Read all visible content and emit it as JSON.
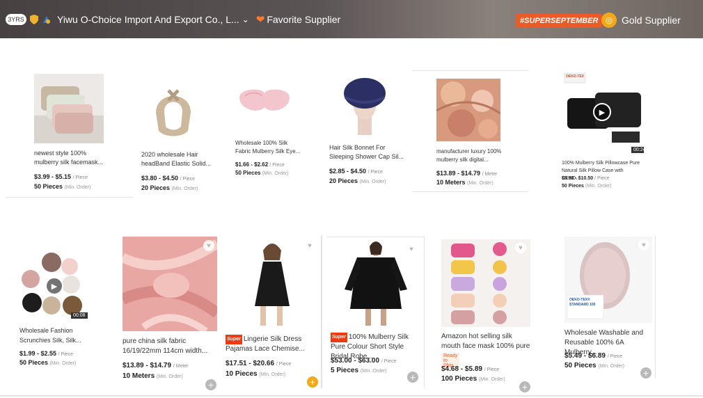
{
  "header": {
    "years": "3YRS",
    "company": "Yiwu O-Choice Import And Export Co., L...",
    "favorite": "Favorite Supplier",
    "promo": "#SUPERSEPTEMBER",
    "gold": "Gold Supplier"
  },
  "row1": [
    {
      "title": "newest style 100% mulberry silk facemask...",
      "price": "$3.99 - $5.15",
      "unit": "/ Piece",
      "moq": "50 Pieces",
      "moq_label": "(Min. Order)"
    },
    {
      "title": "2020 wholesale Hair headBand Elastic Solid...",
      "price": "$3.80 - $4.50",
      "unit": "/ Piece",
      "moq": "20 Pieces",
      "moq_label": "(Min. Order)"
    },
    {
      "title": "Wholesale 100% Silk Fabric Mulberry Silk Eye...",
      "price": "$1.66 - $2.62",
      "unit": "/ Piece",
      "moq": "50 Pieces",
      "moq_label": "(Min. Order)"
    },
    {
      "title": "Hair Silk Bonnet For Sleeping Shower Cap Sil...",
      "price": "$2.85 - $4.50",
      "unit": "/ Piece",
      "moq": "20 Pieces",
      "moq_label": "(Min. Order)"
    },
    {
      "title": "manufacturer luxury 100% mulberry silk digital...",
      "price": "$13.89 - $14.79",
      "unit": "/ Meter",
      "moq": "10 Meters",
      "moq_label": "(Min. Order)"
    },
    {
      "title": "100% Mulberry Silk Pillowcase Pure Natural Silk Pillow Case with OEKO...",
      "price": "$8.90 - $10.50",
      "unit": "/ Piece",
      "moq": "50 Pieces",
      "moq_label": "(Min. Order)",
      "duration": "00:24",
      "badge": "OEKO-TEX"
    }
  ],
  "row2": [
    {
      "title": "Wholesale Fashion Scrunchies Silk, Silk...",
      "price": "$1.99 - $2.55",
      "unit": "/ Piece",
      "moq": "50 Pieces",
      "moq_label": "(Min. Order)",
      "duration": "00:08"
    },
    {
      "title": "pure china silk fabric 16/19/22mm 114cm width...",
      "price": "$13.89 - $14.79",
      "unit": "/ Meter",
      "moq": "10 Meters",
      "moq_label": "(Min. Order)"
    },
    {
      "title": "Lingerie Silk Dress Pajamas Lace Chemise...",
      "price": "$17.51 - $20.66",
      "unit": "/ Piece",
      "moq": "10 Pieces",
      "moq_label": "(Min. Order)",
      "super": "Super"
    },
    {
      "title": "100% Mulberry Silk Pure Colour Short Style Bridal Robe...",
      "price": "$53.00 - $63.00",
      "unit": "/ Piece",
      "moq": "5 Pieces",
      "moq_label": "(Min. Order)",
      "super": "Super"
    },
    {
      "title": "Amazon hot selling silk mouth face mask 100% pure",
      "price": "$4.68 - $5.89",
      "unit": "/ Piece",
      "moq": "100 Pieces",
      "moq_label": "(Min. Order)",
      "rts": "Ready to Ship"
    },
    {
      "title": "Wholesale Washable and Reusable 100% 6A Mulberry...",
      "price": "$5.49 - $6.89",
      "unit": "/ Piece",
      "moq": "50 Pieces",
      "moq_label": "(Min. Order)",
      "badge": "OEKO-TEX® STANDARD 100"
    }
  ],
  "colors": {
    "accent": "#ec5a27",
    "gold": "#f1a91a"
  }
}
